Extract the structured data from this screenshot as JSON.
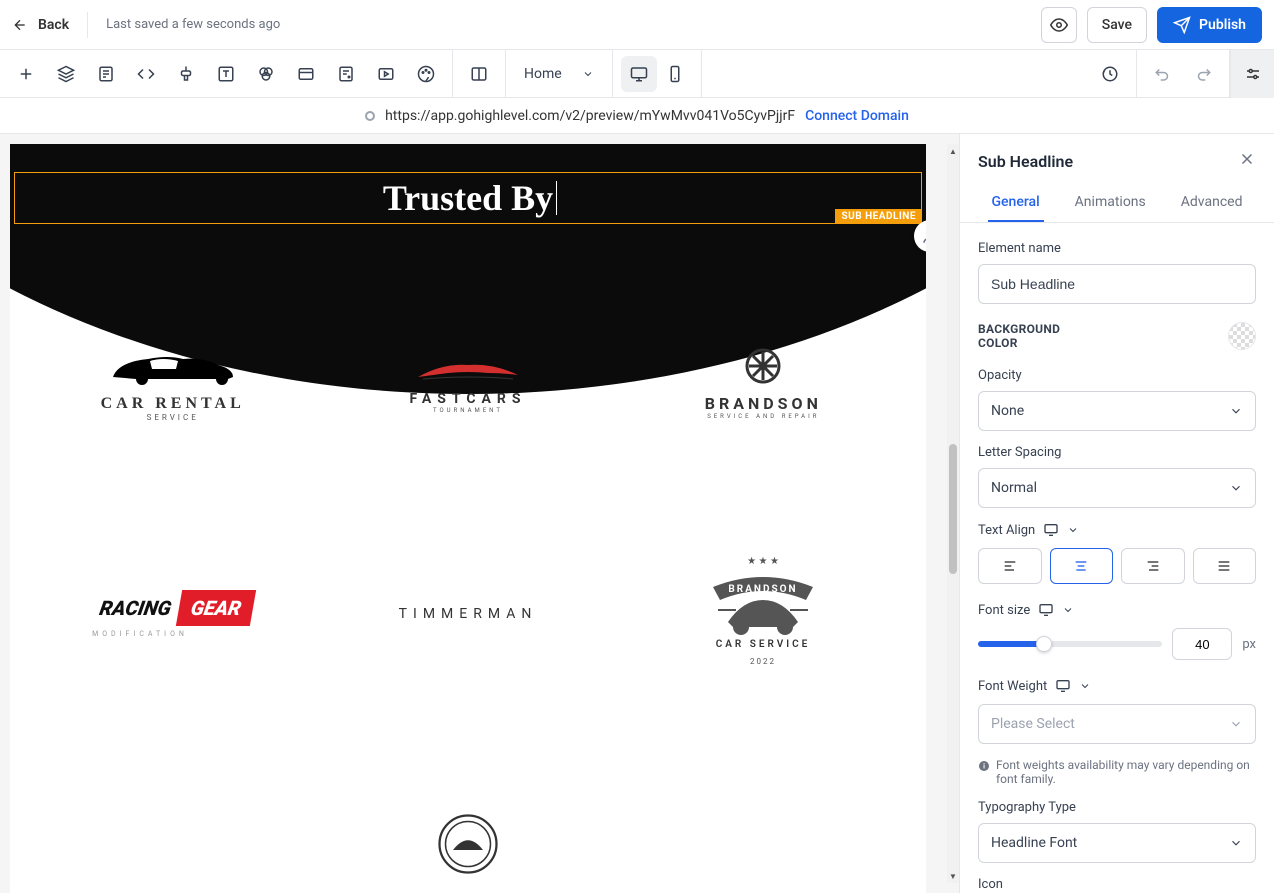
{
  "topbar": {
    "back_label": "Back",
    "last_saved": "Last saved a few seconds ago",
    "save_label": "Save",
    "publish_label": "Publish"
  },
  "toolbar": {
    "page_label": "Home"
  },
  "urlbar": {
    "url": "https://app.gohighlevel.com/v2/preview/mYwMvv041Vo5CyvPjjrF",
    "connect_label": "Connect Domain"
  },
  "canvas": {
    "headline_text": "Trusted By",
    "badge_label": "SUB HEADLINE",
    "logos": {
      "carrental": {
        "line1": "CAR RENTAL",
        "line2": "SERVICE"
      },
      "fastcars": {
        "line1": "FASTCARS",
        "line2": "TOURNAMENT"
      },
      "brandson": {
        "line1": "BRANDSON",
        "line2": "SERVICE AND REPAIR"
      },
      "racinggear": {
        "left": "RACING",
        "right": "GEAR",
        "sub": "MODIFICATION"
      },
      "timmerman": "TIMMERMAN",
      "brandson2": {
        "top": "BRANDSON",
        "mid": "CAR SERVICE",
        "year": "2022"
      }
    }
  },
  "panel": {
    "title": "Sub Headline",
    "tabs": {
      "general": "General",
      "animations": "Animations",
      "advanced": "Advanced"
    },
    "element_name_label": "Element name",
    "element_name_value": "Sub Headline",
    "bg_color_label": "BACKGROUND COLOR",
    "opacity_label": "Opacity",
    "opacity_value": "None",
    "letter_spacing_label": "Letter Spacing",
    "letter_spacing_value": "Normal",
    "text_align_label": "Text Align",
    "font_size_label": "Font size",
    "font_size_value": "40",
    "font_size_unit": "px",
    "font_weight_label": "Font Weight",
    "font_weight_placeholder": "Please Select",
    "font_weight_hint": "Font weights availability may vary depending on font family.",
    "typography_label": "Typography Type",
    "typography_value": "Headline Font",
    "icon_label": "Icon"
  }
}
